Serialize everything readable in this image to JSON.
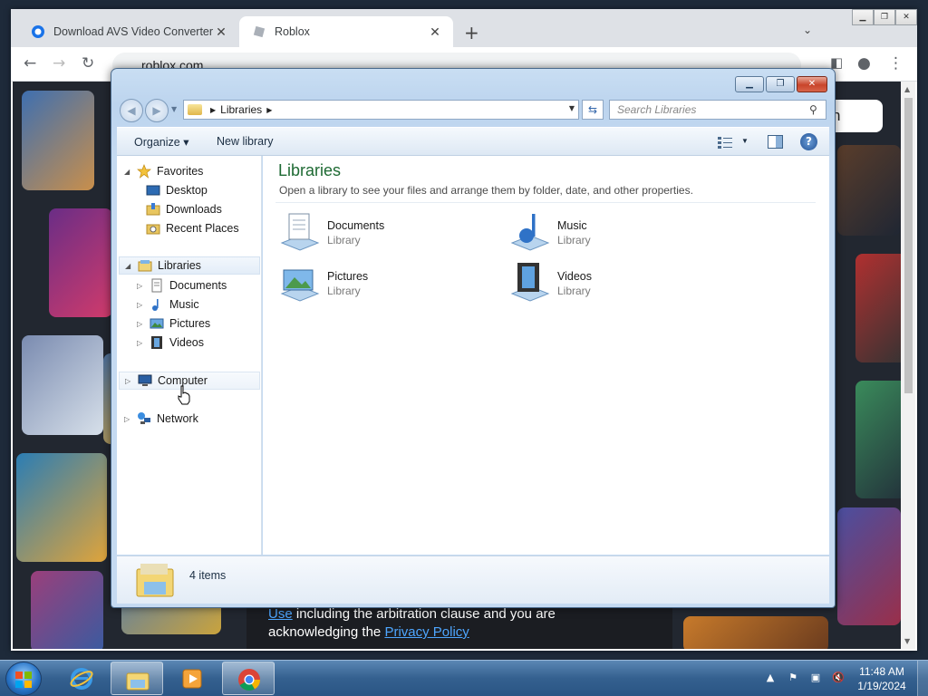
{
  "browser": {
    "tabs": [
      {
        "title": "Download AVS Video Converter ."
      },
      {
        "title": "Roblox"
      }
    ],
    "new_tab": "+",
    "tab_close": "✕",
    "url": "roblox.com",
    "page": {
      "signup_fragment": "n",
      "terms_link_use": "Use",
      "terms_line1_rest": " including the arbitration clause and you are",
      "terms_line2_start": "acknowledging the ",
      "terms_link_privacy": "Privacy Policy"
    }
  },
  "explorer": {
    "breadcrumb": [
      "Libraries"
    ],
    "search_placeholder": "Search Libraries",
    "toolbar": {
      "organize": "Organize ▾",
      "new_library": "New library"
    },
    "nav": {
      "favorites": "Favorites",
      "favorites_items": [
        "Desktop",
        "Downloads",
        "Recent Places"
      ],
      "libraries": "Libraries",
      "libraries_items": [
        "Documents",
        "Music",
        "Pictures",
        "Videos"
      ],
      "computer": "Computer",
      "network": "Network"
    },
    "content": {
      "title": "Libraries",
      "description": "Open a library to see your files and arrange them by folder, date, and other properties.",
      "libraries": [
        {
          "name": "Documents",
          "type": "Library",
          "icon": "documents-library-icon"
        },
        {
          "name": "Music",
          "type": "Library",
          "icon": "music-library-icon"
        },
        {
          "name": "Pictures",
          "type": "Library",
          "icon": "pictures-library-icon"
        },
        {
          "name": "Videos",
          "type": "Library",
          "icon": "videos-library-icon"
        }
      ]
    },
    "status": {
      "item_count": "4 items"
    }
  },
  "taskbar": {
    "clock_time": "11:48 AM",
    "clock_date": "1/19/2024"
  },
  "colors": {
    "libraries_title": "#1e6a33",
    "taskbar": "#34608f",
    "link": "#4ea6ff"
  }
}
